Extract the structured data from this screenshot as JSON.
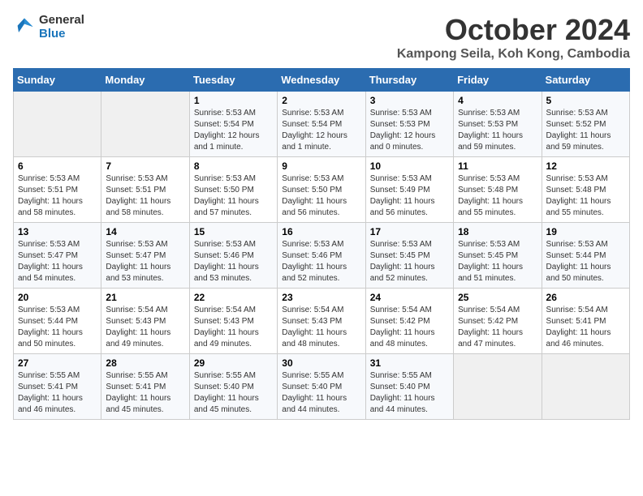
{
  "logo": {
    "line1": "General",
    "line2": "Blue"
  },
  "title": "October 2024",
  "subtitle": "Kampong Seila, Koh Kong, Cambodia",
  "headers": [
    "Sunday",
    "Monday",
    "Tuesday",
    "Wednesday",
    "Thursday",
    "Friday",
    "Saturday"
  ],
  "weeks": [
    [
      {
        "day": "",
        "sunrise": "",
        "sunset": "",
        "daylight": "",
        "empty": true
      },
      {
        "day": "",
        "sunrise": "",
        "sunset": "",
        "daylight": "",
        "empty": true
      },
      {
        "day": "1",
        "sunrise": "Sunrise: 5:53 AM",
        "sunset": "Sunset: 5:54 PM",
        "daylight": "Daylight: 12 hours and 1 minute."
      },
      {
        "day": "2",
        "sunrise": "Sunrise: 5:53 AM",
        "sunset": "Sunset: 5:54 PM",
        "daylight": "Daylight: 12 hours and 1 minute."
      },
      {
        "day": "3",
        "sunrise": "Sunrise: 5:53 AM",
        "sunset": "Sunset: 5:53 PM",
        "daylight": "Daylight: 12 hours and 0 minutes."
      },
      {
        "day": "4",
        "sunrise": "Sunrise: 5:53 AM",
        "sunset": "Sunset: 5:53 PM",
        "daylight": "Daylight: 11 hours and 59 minutes."
      },
      {
        "day": "5",
        "sunrise": "Sunrise: 5:53 AM",
        "sunset": "Sunset: 5:52 PM",
        "daylight": "Daylight: 11 hours and 59 minutes."
      }
    ],
    [
      {
        "day": "6",
        "sunrise": "Sunrise: 5:53 AM",
        "sunset": "Sunset: 5:51 PM",
        "daylight": "Daylight: 11 hours and 58 minutes."
      },
      {
        "day": "7",
        "sunrise": "Sunrise: 5:53 AM",
        "sunset": "Sunset: 5:51 PM",
        "daylight": "Daylight: 11 hours and 58 minutes."
      },
      {
        "day": "8",
        "sunrise": "Sunrise: 5:53 AM",
        "sunset": "Sunset: 5:50 PM",
        "daylight": "Daylight: 11 hours and 57 minutes."
      },
      {
        "day": "9",
        "sunrise": "Sunrise: 5:53 AM",
        "sunset": "Sunset: 5:50 PM",
        "daylight": "Daylight: 11 hours and 56 minutes."
      },
      {
        "day": "10",
        "sunrise": "Sunrise: 5:53 AM",
        "sunset": "Sunset: 5:49 PM",
        "daylight": "Daylight: 11 hours and 56 minutes."
      },
      {
        "day": "11",
        "sunrise": "Sunrise: 5:53 AM",
        "sunset": "Sunset: 5:48 PM",
        "daylight": "Daylight: 11 hours and 55 minutes."
      },
      {
        "day": "12",
        "sunrise": "Sunrise: 5:53 AM",
        "sunset": "Sunset: 5:48 PM",
        "daylight": "Daylight: 11 hours and 55 minutes."
      }
    ],
    [
      {
        "day": "13",
        "sunrise": "Sunrise: 5:53 AM",
        "sunset": "Sunset: 5:47 PM",
        "daylight": "Daylight: 11 hours and 54 minutes."
      },
      {
        "day": "14",
        "sunrise": "Sunrise: 5:53 AM",
        "sunset": "Sunset: 5:47 PM",
        "daylight": "Daylight: 11 hours and 53 minutes."
      },
      {
        "day": "15",
        "sunrise": "Sunrise: 5:53 AM",
        "sunset": "Sunset: 5:46 PM",
        "daylight": "Daylight: 11 hours and 53 minutes."
      },
      {
        "day": "16",
        "sunrise": "Sunrise: 5:53 AM",
        "sunset": "Sunset: 5:46 PM",
        "daylight": "Daylight: 11 hours and 52 minutes."
      },
      {
        "day": "17",
        "sunrise": "Sunrise: 5:53 AM",
        "sunset": "Sunset: 5:45 PM",
        "daylight": "Daylight: 11 hours and 52 minutes."
      },
      {
        "day": "18",
        "sunrise": "Sunrise: 5:53 AM",
        "sunset": "Sunset: 5:45 PM",
        "daylight": "Daylight: 11 hours and 51 minutes."
      },
      {
        "day": "19",
        "sunrise": "Sunrise: 5:53 AM",
        "sunset": "Sunset: 5:44 PM",
        "daylight": "Daylight: 11 hours and 50 minutes."
      }
    ],
    [
      {
        "day": "20",
        "sunrise": "Sunrise: 5:53 AM",
        "sunset": "Sunset: 5:44 PM",
        "daylight": "Daylight: 11 hours and 50 minutes."
      },
      {
        "day": "21",
        "sunrise": "Sunrise: 5:54 AM",
        "sunset": "Sunset: 5:43 PM",
        "daylight": "Daylight: 11 hours and 49 minutes."
      },
      {
        "day": "22",
        "sunrise": "Sunrise: 5:54 AM",
        "sunset": "Sunset: 5:43 PM",
        "daylight": "Daylight: 11 hours and 49 minutes."
      },
      {
        "day": "23",
        "sunrise": "Sunrise: 5:54 AM",
        "sunset": "Sunset: 5:43 PM",
        "daylight": "Daylight: 11 hours and 48 minutes."
      },
      {
        "day": "24",
        "sunrise": "Sunrise: 5:54 AM",
        "sunset": "Sunset: 5:42 PM",
        "daylight": "Daylight: 11 hours and 48 minutes."
      },
      {
        "day": "25",
        "sunrise": "Sunrise: 5:54 AM",
        "sunset": "Sunset: 5:42 PM",
        "daylight": "Daylight: 11 hours and 47 minutes."
      },
      {
        "day": "26",
        "sunrise": "Sunrise: 5:54 AM",
        "sunset": "Sunset: 5:41 PM",
        "daylight": "Daylight: 11 hours and 46 minutes."
      }
    ],
    [
      {
        "day": "27",
        "sunrise": "Sunrise: 5:55 AM",
        "sunset": "Sunset: 5:41 PM",
        "daylight": "Daylight: 11 hours and 46 minutes."
      },
      {
        "day": "28",
        "sunrise": "Sunrise: 5:55 AM",
        "sunset": "Sunset: 5:41 PM",
        "daylight": "Daylight: 11 hours and 45 minutes."
      },
      {
        "day": "29",
        "sunrise": "Sunrise: 5:55 AM",
        "sunset": "Sunset: 5:40 PM",
        "daylight": "Daylight: 11 hours and 45 minutes."
      },
      {
        "day": "30",
        "sunrise": "Sunrise: 5:55 AM",
        "sunset": "Sunset: 5:40 PM",
        "daylight": "Daylight: 11 hours and 44 minutes."
      },
      {
        "day": "31",
        "sunrise": "Sunrise: 5:55 AM",
        "sunset": "Sunset: 5:40 PM",
        "daylight": "Daylight: 11 hours and 44 minutes."
      },
      {
        "day": "",
        "sunrise": "",
        "sunset": "",
        "daylight": "",
        "empty": true
      },
      {
        "day": "",
        "sunrise": "",
        "sunset": "",
        "daylight": "",
        "empty": true
      }
    ]
  ]
}
